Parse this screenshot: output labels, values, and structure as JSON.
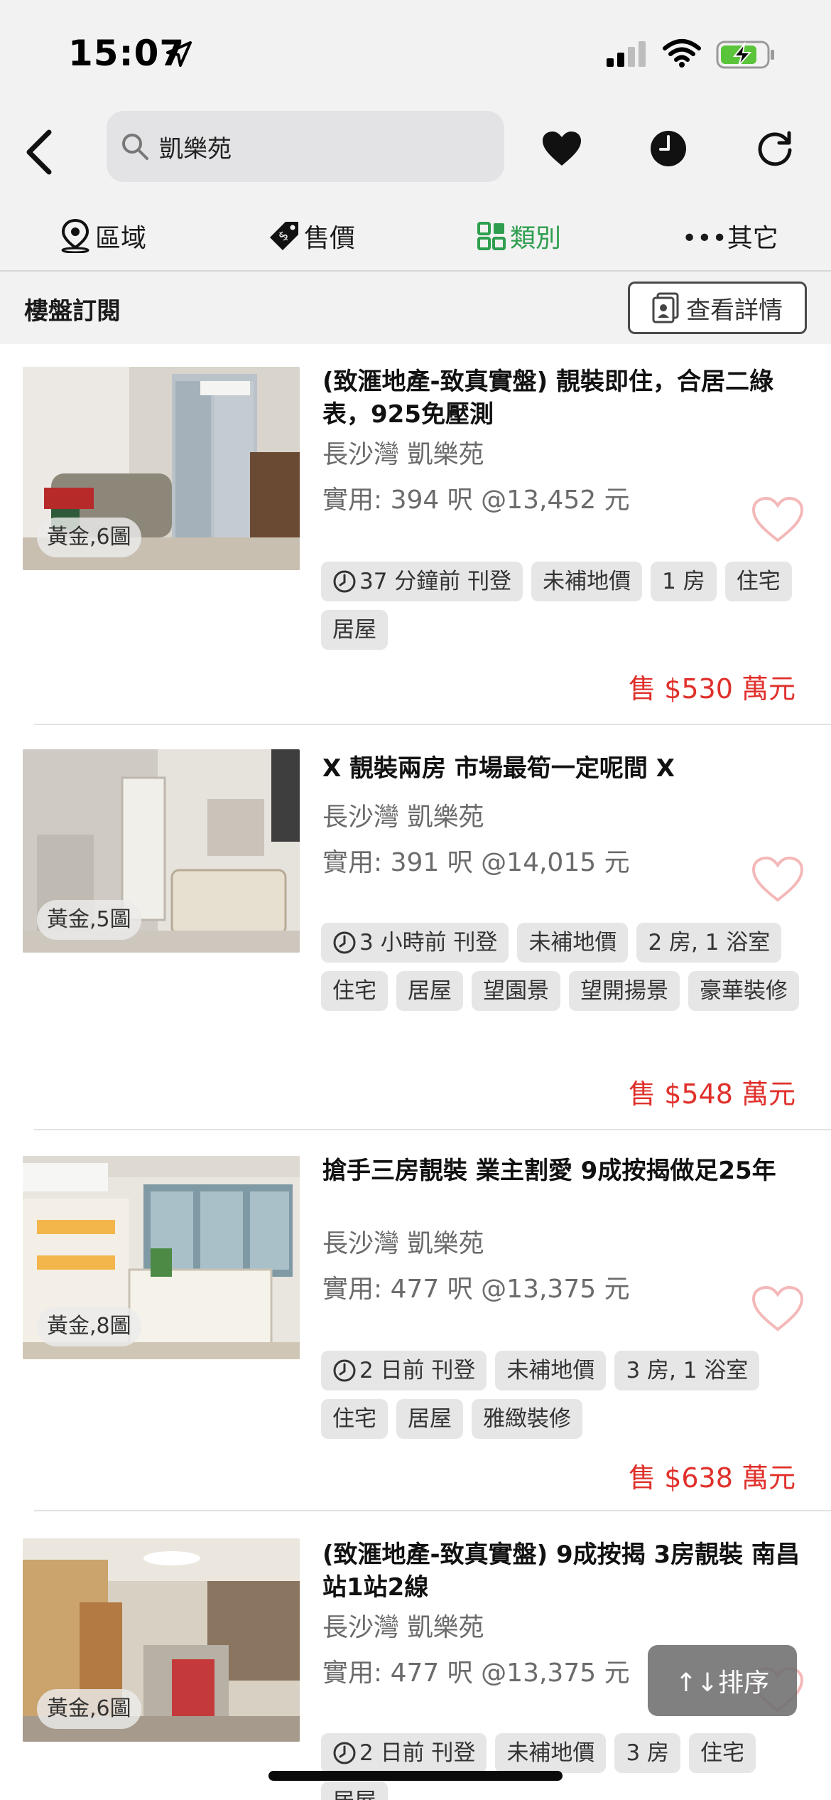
{
  "status_bar": {
    "time": "15:07"
  },
  "header": {
    "search_query": "凱樂苑",
    "icons": [
      "back-icon",
      "search-icon",
      "heart-icon",
      "clock-icon",
      "refresh-icon"
    ]
  },
  "filters": [
    {
      "label": "區域",
      "icon": "map-pin-icon"
    },
    {
      "label": "售價",
      "icon": "price-tag-icon"
    },
    {
      "label": "類別",
      "icon": "category-grid-icon"
    },
    {
      "label": "•••其它",
      "icon": ""
    }
  ],
  "subscription": {
    "title": "樓盤訂閱",
    "details_label": "查看詳情"
  },
  "listings": [
    {
      "title": "(致滙地產-致真實盤) 靚裝即住，合居二綠表，925免壓測",
      "location": "長沙灣 凱樂苑",
      "size": "實用: 394 呎  @13,452 元",
      "photo_badge": "黃金,6圖",
      "tags": [
        "37 分鐘前 刊登",
        "未補地價",
        "1 房",
        "住宅",
        "居屋"
      ],
      "price": "售 $530 萬元"
    },
    {
      "title": "X 靚裝兩房 市場最筍一定呢間 X",
      "location": "長沙灣 凱樂苑",
      "size": "實用: 391 呎  @14,015 元",
      "photo_badge": "黃金,5圖",
      "tags": [
        "3 小時前 刊登",
        "未補地價",
        "2 房, 1 浴室",
        "住宅",
        "居屋",
        "望園景",
        "望開揚景",
        "豪華裝修"
      ],
      "price": "售 $548 萬元"
    },
    {
      "title": "搶手三房靚裝 業主割愛 9成按揭做足25年",
      "location": "長沙灣 凱樂苑",
      "size": "實用: 477 呎  @13,375 元",
      "photo_badge": "黃金,8圖",
      "tags": [
        "2 日前 刊登",
        "未補地價",
        "3 房, 1 浴室",
        "住宅",
        "居屋",
        "雅緻裝修"
      ],
      "price": "售 $638 萬元"
    },
    {
      "title": "(致滙地產-致真實盤) 9成按揭 3房靚裝 南昌站1站2線",
      "location": "長沙灣 凱樂苑",
      "size": "實用: 477 呎  @13,375 元",
      "photo_badge": "黃金,6圖",
      "tags": [
        "2 日前 刊登",
        "未補地價",
        "3 房",
        "住宅",
        "居屋"
      ],
      "price": ""
    }
  ],
  "sort_button": {
    "label": "↑↓排序"
  },
  "colors": {
    "accent_green": "#2f9e4f",
    "price_red": "#e0302b",
    "heart_pink": "#f4b8b8"
  }
}
